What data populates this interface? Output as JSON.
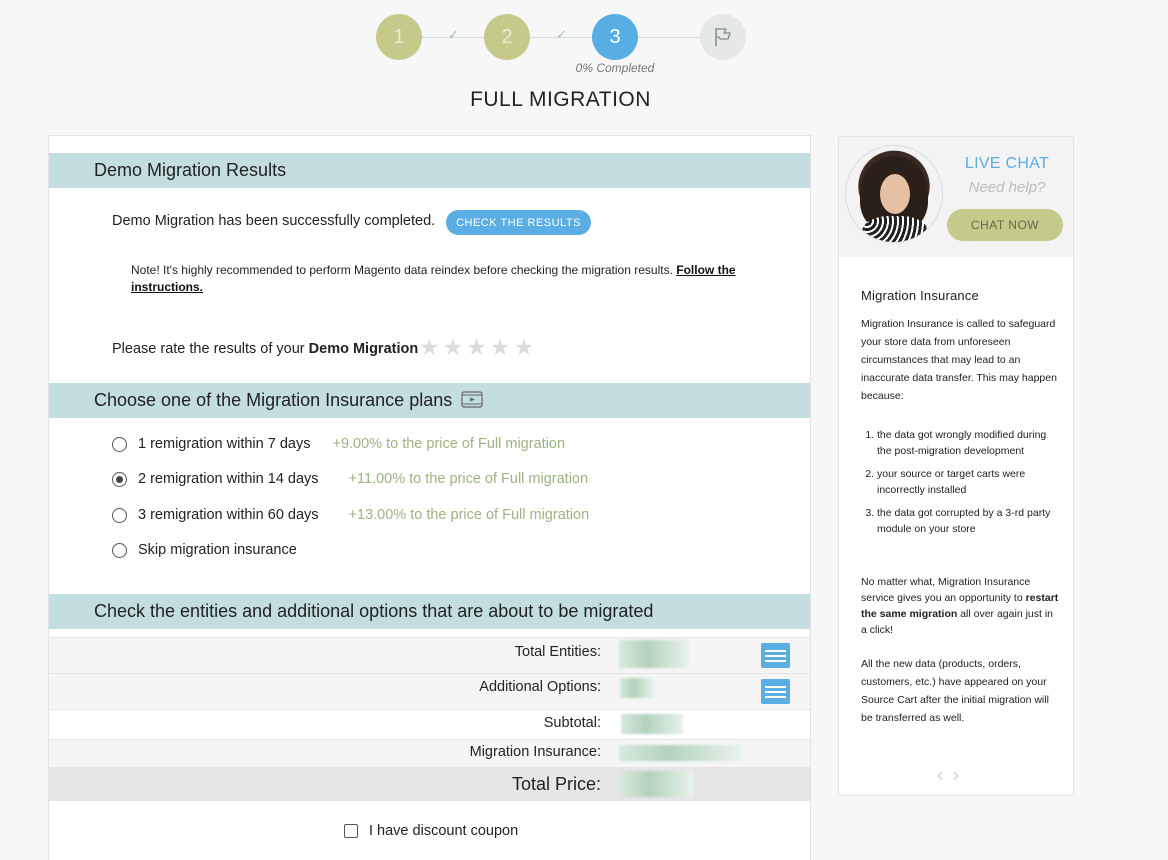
{
  "stepper": {
    "steps": [
      "1",
      "2",
      "3"
    ],
    "check_mark": "✓",
    "flag_icon": "flag-icon",
    "progress_text": "0% Completed"
  },
  "page_title": "FULL MIGRATION",
  "demo_section": {
    "heading": "Demo Migration Results",
    "status_text": "Demo Migration has been successfully completed.",
    "check_button": "CHECK THE RESULTS",
    "note_text": "Note! It's highly recommended to perform Magento data reindex before checking the migration results. ",
    "note_link": "Follow the instructions.",
    "rate_prefix": "Please rate the results of your ",
    "rate_bold": "Demo Migration",
    "rating": 0,
    "star_glyph": "★"
  },
  "insurance_section": {
    "heading": "Choose one of the Migration Insurance plans",
    "plans": [
      {
        "label": "1 remigration within 7 days",
        "price": "+9.00% to the price of Full migration",
        "selected": false
      },
      {
        "label": "2 remigration within 14 days",
        "price": "+11.00% to the price of Full migration",
        "selected": true
      },
      {
        "label": "3 remigration within 60 days",
        "price": "+13.00% to the price of Full migration",
        "selected": false
      },
      {
        "label": "Skip migration insurance",
        "price": "",
        "selected": false
      }
    ]
  },
  "entities_section": {
    "heading": "Check the entities and additional options that are about to be migrated",
    "rows": {
      "total_entities": "Total Entities:",
      "additional_options": "Additional Options:",
      "subtotal": "Subtotal:",
      "migration_insurance": "Migration Insurance:",
      "total_price": "Total Price:"
    },
    "coupon_label": "I have discount coupon"
  },
  "side_panel": {
    "live_chat": "LIVE CHAT",
    "need_help": "Need help?",
    "chat_button": "CHAT NOW",
    "title": "Migration Insurance",
    "intro": "Migration Insurance is called to safeguard your store data from unforeseen circumstances that may lead to an inaccurate data transfer. This may happen because:",
    "reasons": [
      "the data got wrongly modified during the post-migration development",
      "your source or target carts were incorrectly installed",
      "the data got corrupted by a 3-rd party module on your store"
    ],
    "para2_prefix": "No matter what, Migration Insurance service gives you an opportunity to ",
    "para2_bold": "restart the same migration",
    "para2_suffix": " all over again just in a click!",
    "para3": "All the new data (products, orders, customers, etc.) have appeared on your Source Cart after the initial migration will be transferred as well.",
    "prev_glyph": "‹",
    "next_glyph": "›"
  },
  "colors": {
    "accent_blue": "#5aaee4",
    "step_done": "#c5c98a",
    "section_header": "#c3dde1",
    "price_green": "#9ab482"
  }
}
